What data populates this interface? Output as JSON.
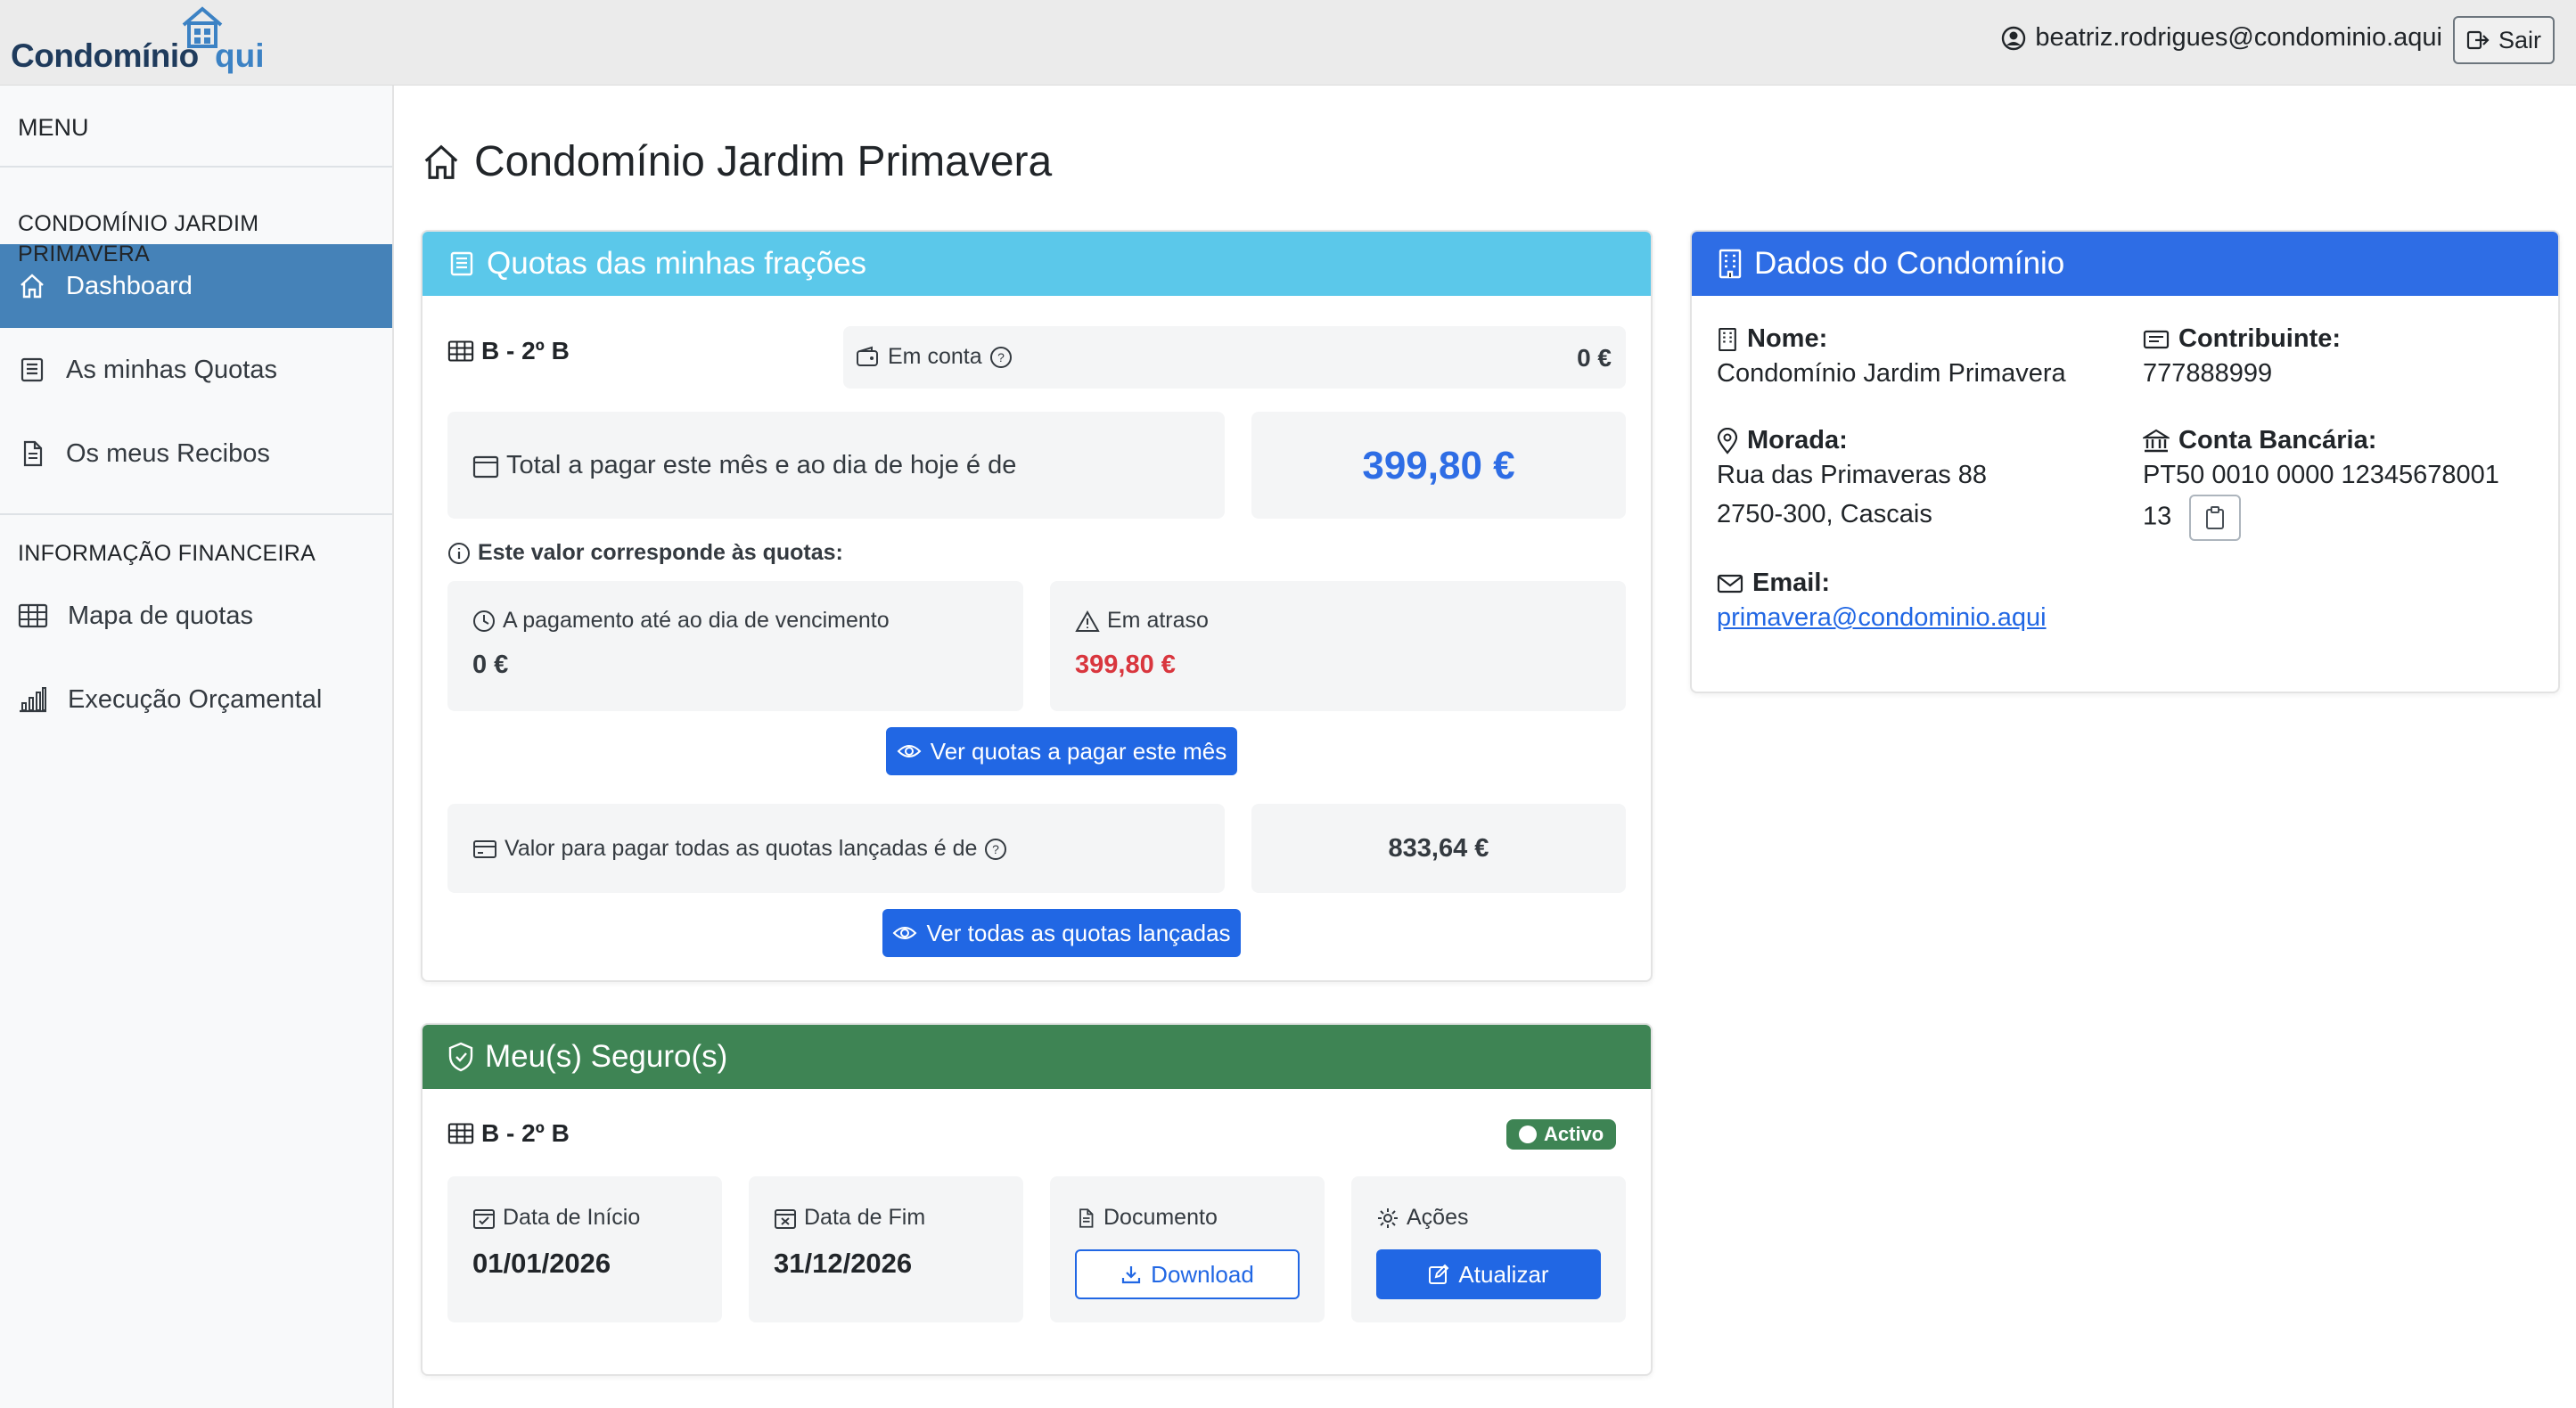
{
  "app": {
    "logo_part1": "Condomínio",
    "logo_part2": "qui",
    "user_email": "beatriz.rodrigues@condominio.aqui",
    "logout_label": "Sair"
  },
  "sidebar": {
    "menu_title": "MENU",
    "section1": "CONDOMÍNIO JARDIM PRIMAVERA",
    "items1": [
      {
        "label": "Dashboard",
        "icon": "home-icon"
      },
      {
        "label": "As minhas Quotas",
        "icon": "receipt-icon"
      },
      {
        "label": "Os meus Recibos",
        "icon": "file-icon"
      }
    ],
    "section2": "INFORMAÇÃO FINANCEIRA",
    "items2": [
      {
        "label": "Mapa de quotas",
        "icon": "table-icon"
      },
      {
        "label": "Execução Orçamental",
        "icon": "bar-chart-icon"
      }
    ]
  },
  "page": {
    "title": "Condomínio Jardim Primavera"
  },
  "quotas": {
    "header": "Quotas das minhas frações",
    "fraction": "B - 2º B",
    "em_conta_label": "Em conta",
    "em_conta_value": "0 €",
    "total_label": "Total a pagar este mês e ao dia de hoje é de",
    "total_value": "399,80 €",
    "note": "Este valor corresponde às quotas:",
    "a_pagamento_label": "A pagamento até ao dia de vencimento",
    "a_pagamento_value": "0 €",
    "em_atraso_label": "Em atraso",
    "em_atraso_value": "399,80 €",
    "btn_mes": "Ver quotas a pagar este mês",
    "todas_label": "Valor para pagar todas as quotas lançadas é de",
    "todas_value": "833,64 €",
    "btn_todas": "Ver todas as quotas lançadas"
  },
  "dados": {
    "header": "Dados do Condomínio",
    "nome_label": "Nome:",
    "nome_value": "Condomínio Jardim Primavera",
    "contribuinte_label": "Contribuinte:",
    "contribuinte_value": "777888999",
    "morada_label": "Morada:",
    "morada_line1": "Rua das Primaveras 88",
    "morada_line2": "2750-300, Cascais",
    "conta_label": "Conta Bancária:",
    "conta_line1": "PT50 0010 0000 12345678001",
    "conta_line2": "13",
    "email_label": "Email:",
    "email_value": "primavera@condominio.aqui"
  },
  "seguros": {
    "header": "Meu(s) Seguro(s)",
    "fraction": "B - 2º B",
    "status": "Activo",
    "inicio_label": "Data de Início",
    "inicio_value": "01/01/2026",
    "fim_label": "Data de Fim",
    "fim_value": "31/12/2026",
    "documento_label": "Documento",
    "download_label": "Download",
    "acoes_label": "Ações",
    "atualizar_label": "Atualizar"
  },
  "colors": {
    "sidebar_active": "#4582b8",
    "quotas_header": "#5bc8ea",
    "dados_header": "#2e6de5",
    "seguros_header": "#3e8454",
    "primary": "#2167e4",
    "danger": "#d9363e"
  }
}
